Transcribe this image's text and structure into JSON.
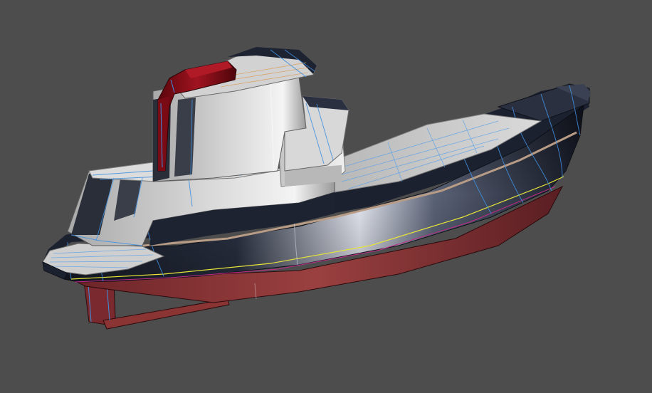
{
  "viewport": {
    "background_color": "#4d4d4d"
  },
  "model": {
    "colors": {
      "hull_topside": "#1c2130",
      "hull_highlight": "#dfe3ee",
      "bottom_paint": "#8a3434",
      "bottom_paint_dark": "#5a1e22",
      "deck": "#c9c9c9",
      "deck_dark": "#9d9d9d",
      "superstructure": "#bdbdbd",
      "superstructure_light": "#ececec",
      "stack": "#8a0a14",
      "stack_dark": "#4e050b",
      "rub_rail": "#b89c86",
      "waterline": "#e7e43a",
      "wireframe": "#3f8fe0",
      "deck_stripe": "#d9a46a"
    }
  }
}
